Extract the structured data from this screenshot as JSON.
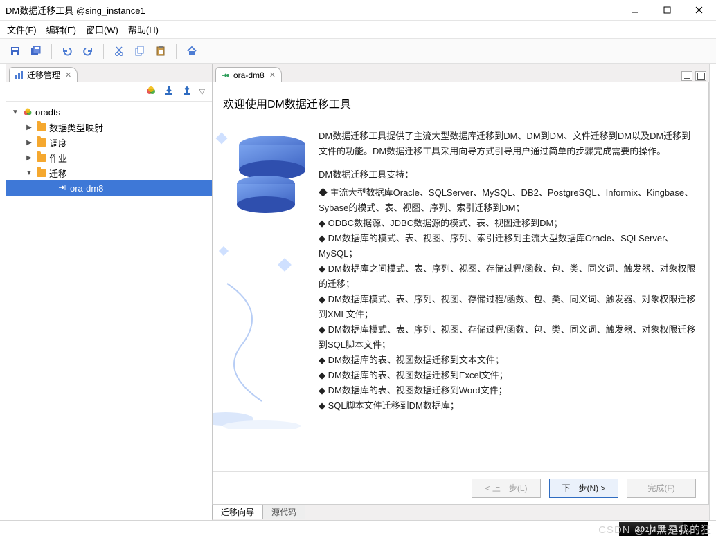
{
  "window": {
    "title": "DM数据迁移工具 @sing_instance1"
  },
  "menu": {
    "file": "文件(F)",
    "edit": "编辑(E)",
    "window": "窗口(W)",
    "help": "帮助(H)"
  },
  "toolbar_icons": {
    "save": "save-icon",
    "save_all": "save-all-icon",
    "undo": "undo-icon",
    "redo": "redo-icon",
    "cut": "cut-icon",
    "copy": "copy-icon",
    "paste": "paste-icon",
    "home": "home-icon"
  },
  "left_panel": {
    "title": "迁移管理",
    "tree": {
      "root_label": "oradts",
      "items": [
        {
          "label": "数据类型映射",
          "expanded": false
        },
        {
          "label": "调度",
          "expanded": false
        },
        {
          "label": "作业",
          "expanded": false
        },
        {
          "label": "迁移",
          "expanded": true,
          "children": [
            {
              "label": "ora-dm8",
              "selected": true
            }
          ]
        }
      ]
    }
  },
  "editor": {
    "tab_label": "ora-dm8",
    "welcome_heading": "欢迎使用DM数据迁移工具",
    "intro": "DM数据迁移工具提供了主流大型数据库迁移到DM、DM到DM、文件迁移到DM以及DM迁移到文件的功能。DM数据迁移工具采用向导方式引导用户通过简单的步骤完成需要的操作。",
    "support_heading": "DM数据迁移工具支持：",
    "bullets": [
      "主流大型数据库Oracle、SQLServer、MySQL、DB2、PostgreSQL、Informix、Kingbase、Sybase的模式、表、视图、序列、索引迁移到DM；",
      "ODBC数据源、JDBC数据源的模式、表、视图迁移到DM；",
      "DM数据库的模式、表、视图、序列、索引迁移到主流大型数据库Oracle、SQLServer、MySQL；",
      "DM数据库之间模式、表、序列、视图、存储过程/函数、包、类、同义词、触发器、对象权限的迁移；",
      "DM数据库模式、表、序列、视图、存储过程/函数、包、类、同义词、触发器、对象权限迁移到XML文件；",
      "DM数据库模式、表、序列、视图、存储过程/函数、包、类、同义词、触发器、对象权限迁移到SQL脚本文件；",
      "DM数据库的表、视图数据迁移到文本文件；",
      "DM数据库的表、视图数据迁移到Excel文件；",
      "DM数据库的表、视图数据迁移到Word文件；",
      "SQL脚本文件迁移到DM数据库；"
    ],
    "buttons": {
      "prev": "< 上一步(L)",
      "next": "下一步(N) >",
      "finish": "完成(F)"
    },
    "bottom_tabs": {
      "wizard": "迁移向导",
      "source": "源代码"
    }
  },
  "statusbar": {
    "memory": "301M 共 412…"
  },
  "watermark": "CSDN @小黑是我的狂"
}
